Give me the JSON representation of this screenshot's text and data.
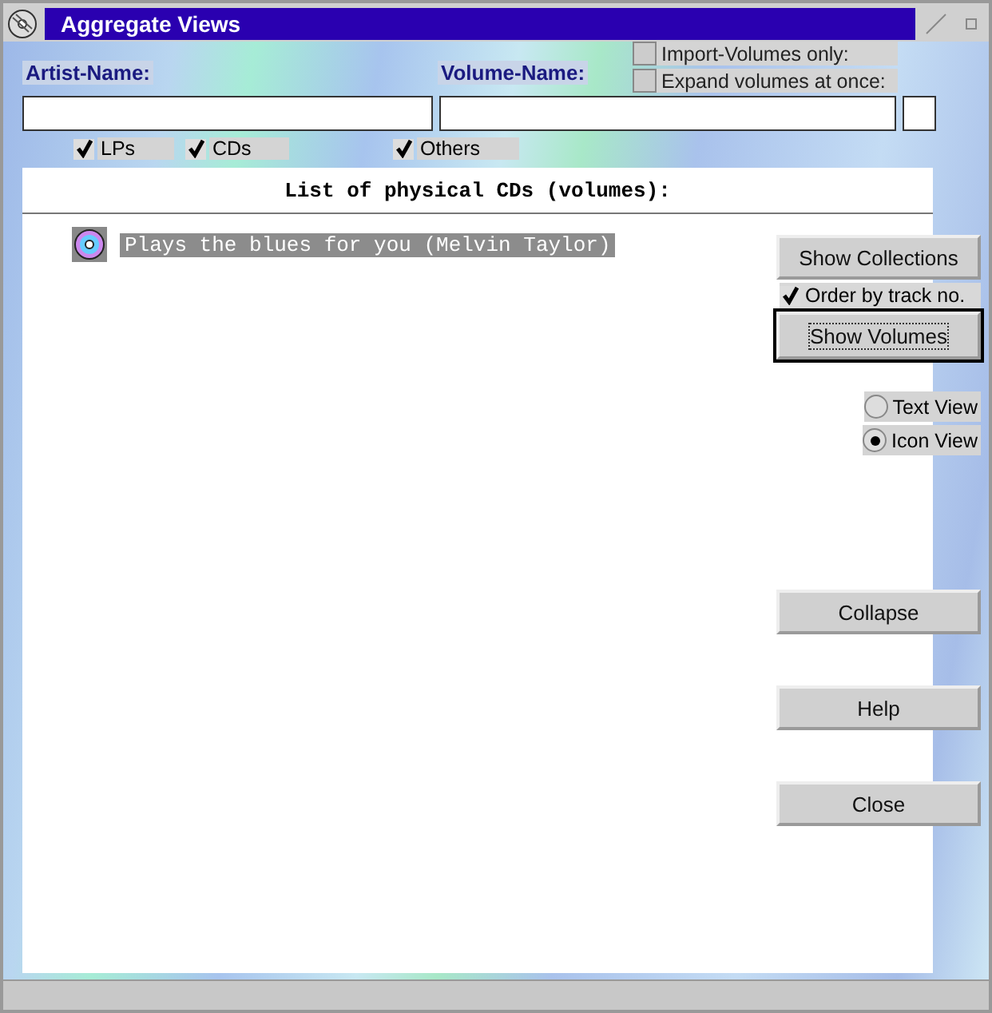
{
  "window": {
    "title": "Aggregate Views"
  },
  "fields": [
    {
      "label": "Artist-Name:"
    },
    {
      "label": "Volume-Name:"
    }
  ],
  "options": [
    {
      "label": "Import-Volumes only:",
      "checked": false
    },
    {
      "label": "Expand volumes at once:",
      "checked": false
    }
  ],
  "filters": [
    {
      "label": "LPs",
      "checked": true
    },
    {
      "label": "CDs",
      "checked": true
    },
    {
      "label": "Others",
      "checked": true
    }
  ],
  "list": {
    "heading": "List of physical CDs (volumes):",
    "items": [
      {
        "label": "Plays the blues for you (Melvin Taylor)",
        "selected": true
      }
    ]
  },
  "controls": [
    {
      "kind": "button",
      "label": "Show Collections",
      "focused": false
    },
    {
      "kind": "checkbox",
      "label": "Order by track no.",
      "checked": true
    },
    {
      "kind": "button",
      "label": "Show Volumes",
      "focused": true
    },
    {
      "kind": "radio",
      "label": "Text View",
      "selected": false
    },
    {
      "kind": "radio",
      "label": "Icon View",
      "selected": true
    },
    {
      "kind": "button",
      "label": "Collapse",
      "focused": false
    },
    {
      "kind": "button",
      "label": "Help",
      "focused": false
    },
    {
      "kind": "button",
      "label": "Close",
      "focused": false
    }
  ]
}
